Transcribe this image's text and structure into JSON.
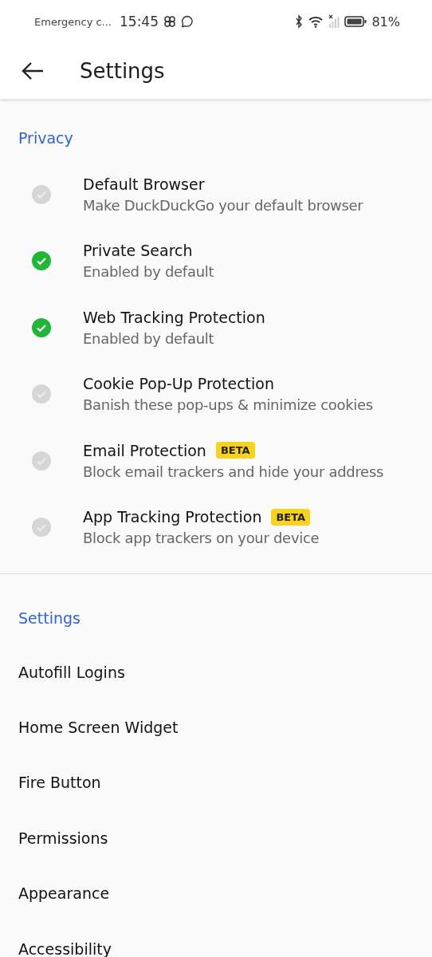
{
  "status_bar": {
    "carrier": "Emergency c...",
    "time": "15:45",
    "battery": "81%"
  },
  "app_bar": {
    "title": "Settings"
  },
  "privacy": {
    "heading": "Privacy",
    "items": [
      {
        "title": "Default Browser",
        "subtitle": "Make DuckDuckGo your default browser",
        "checked": false
      },
      {
        "title": "Private Search",
        "subtitle": "Enabled by default",
        "checked": true
      },
      {
        "title": "Web Tracking Protection",
        "subtitle": "Enabled by default",
        "checked": true
      },
      {
        "title": "Cookie Pop-Up Protection",
        "subtitle": "Banish these pop-ups & minimize cookies",
        "checked": false
      },
      {
        "title": "Email Protection",
        "badge": "BETA",
        "subtitle": "Block email trackers and hide your address",
        "checked": false
      },
      {
        "title": "App Tracking Protection",
        "badge": "BETA",
        "subtitle": "Block app trackers on your device",
        "checked": false
      }
    ]
  },
  "settings": {
    "heading": "Settings",
    "items": [
      {
        "label": "Autofill Logins"
      },
      {
        "label": "Home Screen Widget"
      },
      {
        "label": "Fire Button"
      },
      {
        "label": "Permissions"
      },
      {
        "label": "Appearance"
      },
      {
        "label": "Accessibility"
      }
    ]
  }
}
